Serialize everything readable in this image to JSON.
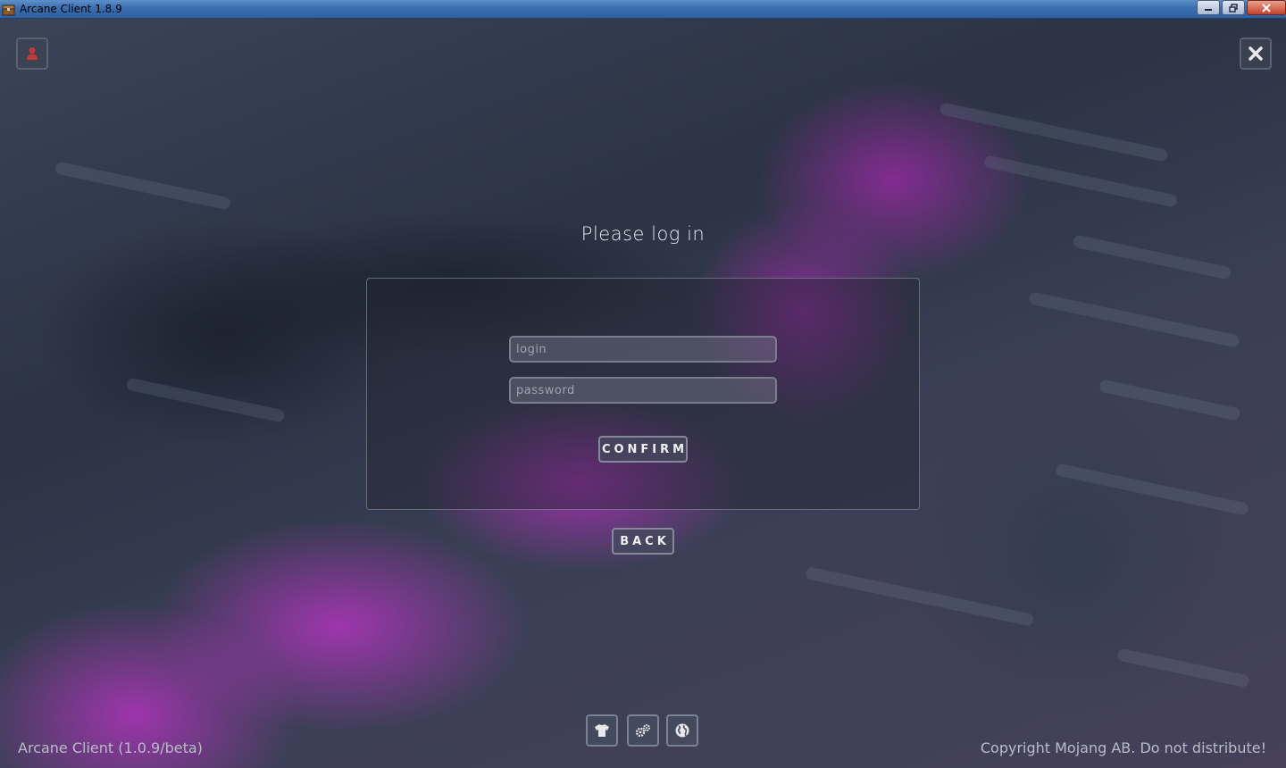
{
  "window": {
    "title": "Arcane Client 1.8.9",
    "controls": [
      "minimize",
      "restore",
      "close"
    ]
  },
  "screen": {
    "heading": "Please log in",
    "login_field": {
      "value": "",
      "placeholder": "login"
    },
    "password_field": {
      "value": "",
      "placeholder": "password"
    },
    "confirm_label": "CONFIRM",
    "back_label": "BACK"
  },
  "corner_buttons": {
    "account_icon": "user-icon",
    "close_icon": "close-icon"
  },
  "toolbar": {
    "items": [
      {
        "icon": "shirt-icon",
        "name": "skin"
      },
      {
        "icon": "settings-icon",
        "name": "settings"
      },
      {
        "icon": "globe-icon",
        "name": "language"
      }
    ]
  },
  "footer": {
    "version": "Arcane Client (1.0.9/beta)",
    "copyright": "Copyright Mojang AB. Do not distribute!"
  },
  "colors": {
    "accent_purple": "#b030c0",
    "account_icon": "#c0393b",
    "text_light": "#e6e8ee"
  }
}
